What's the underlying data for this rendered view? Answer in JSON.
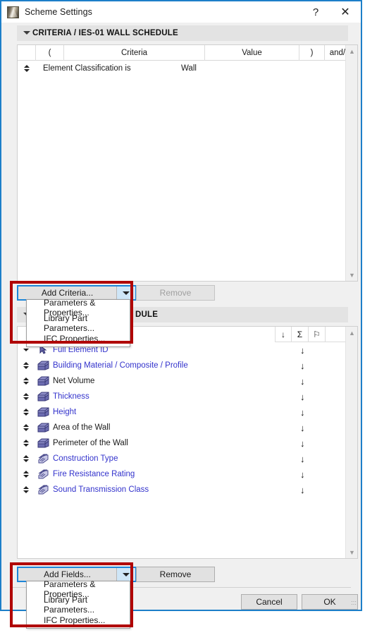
{
  "window": {
    "title": "Scheme Settings",
    "icon": "archicad-logo-icon",
    "help_label": "?",
    "close_label": "✕"
  },
  "criteria_section": {
    "header": "CRITERIA / IES-01 WALL SCHEDULE",
    "columns": [
      "",
      "(",
      "Criteria",
      "Value",
      ")",
      "and/or"
    ],
    "rows": [
      {
        "criteria": "Element Classification is",
        "value": "Wall",
        "open_paren": "",
        "close_paren": "",
        "andor": ""
      }
    ],
    "add_button": {
      "label": "Add Criteria...",
      "menu": [
        "Parameters & Properties...",
        "Library Part Parameters...",
        "IFC Properties..."
      ]
    },
    "remove_button": {
      "label": "Remove",
      "enabled": false
    }
  },
  "fields_section": {
    "header_visible_fragment": "DULE",
    "column_icons": [
      "sort-down-icon",
      "sum-icon",
      "flag-icon"
    ],
    "rows": [
      {
        "label": "Full Element ID",
        "icon": "cursor-icon",
        "link": true,
        "arrow": "↓"
      },
      {
        "label": "Building Material / Composite / Profile",
        "icon": "parameter-box-icon",
        "link": true,
        "arrow": "↓"
      },
      {
        "label": "Net Volume",
        "icon": "parameter-box-icon",
        "link": false,
        "arrow": "↓"
      },
      {
        "label": "Thickness",
        "icon": "parameter-box-icon",
        "link": true,
        "arrow": "↓"
      },
      {
        "label": "Height",
        "icon": "parameter-box-icon",
        "link": true,
        "arrow": "↓"
      },
      {
        "label": "Area of the Wall",
        "icon": "parameter-box-icon",
        "link": false,
        "arrow": "↓"
      },
      {
        "label": "Perimeter of the Wall",
        "icon": "parameter-box-icon",
        "link": false,
        "arrow": "↓"
      },
      {
        "label": "Construction Type",
        "icon": "property-tag-icon",
        "link": true,
        "arrow": "↓"
      },
      {
        "label": "Fire Resistance Rating",
        "icon": "property-tag-icon",
        "link": true,
        "arrow": "↓"
      },
      {
        "label": "Sound Transmission Class",
        "icon": "property-tag-icon",
        "link": true,
        "arrow": "↓"
      }
    ],
    "add_button": {
      "label": "Add Fields...",
      "menu": [
        "Parameters & Properties...",
        "Library Part Parameters...",
        "IFC Properties..."
      ]
    },
    "remove_button": {
      "label": "Remove",
      "enabled": true
    }
  },
  "footer": {
    "cancel_label": "Cancel",
    "ok_label": "OK"
  },
  "colors": {
    "window_border": "#1d7fc9",
    "focus_border": "#1d86d8",
    "highlight_box": "#b00000",
    "link_text": "#3333cc",
    "section_header_bg": "#e3e3e3",
    "dropdown_arrow_bg": "#cfe6f7"
  }
}
